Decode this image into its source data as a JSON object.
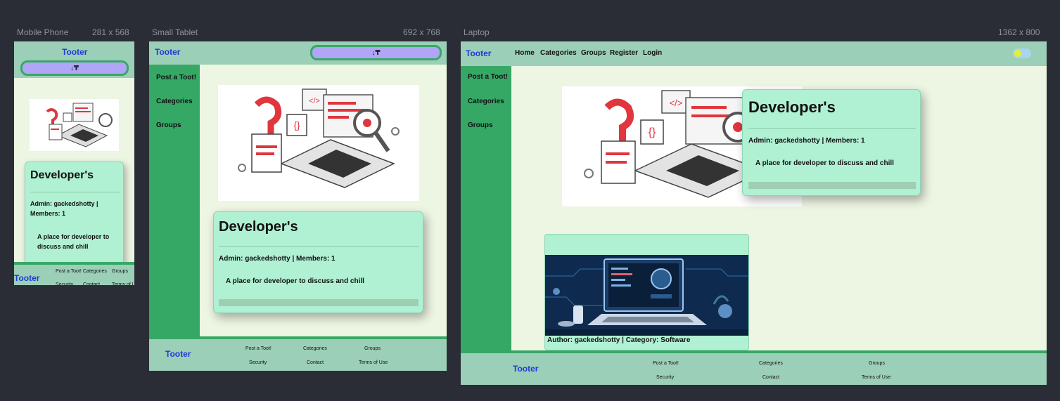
{
  "viewports": {
    "mobile": {
      "name": "Mobile Phone",
      "size": "281 x 568"
    },
    "tablet": {
      "name": "Small Tablet",
      "size": "692 x 768"
    },
    "laptop": {
      "name": "Laptop",
      "size": "1362 x 800"
    }
  },
  "app": {
    "logo": "Tooter",
    "sort_icon": "↓₸"
  },
  "nav": {
    "home": "Home",
    "categories": "Categories",
    "groups": "Groups",
    "register": "Register",
    "login": "Login"
  },
  "sidebar": {
    "post": "Post a Toot!",
    "categories": "Categories",
    "groups": "Groups"
  },
  "group_card": {
    "title": "Developer's",
    "meta": "Admin: gackedshotty | Members: 1",
    "meta_line1": "Admin: gackedshotty |",
    "meta_line2": "Members: 1",
    "description": "A place for developer to discuss and chill",
    "desc_line1": "A place for developer to",
    "desc_line2": "discuss and chill"
  },
  "toot_card": {
    "meta": "Author: gackedshotty | Category: Software"
  },
  "footer": {
    "post": "Post a Toot!",
    "categories": "Categories",
    "groups": "Groups",
    "security": "Security",
    "contact": "Contact",
    "terms": "Terms of Use"
  },
  "colors": {
    "header": "#9ccfb7",
    "sidebar": "#36a866",
    "card": "#b0f0d3",
    "sort_button": "#b0a5f6",
    "logo": "#1e3ad8",
    "content_bg": "#edf5e3",
    "toggle_knob": "#e5f033",
    "toggle_track": "#a8d5f0"
  }
}
